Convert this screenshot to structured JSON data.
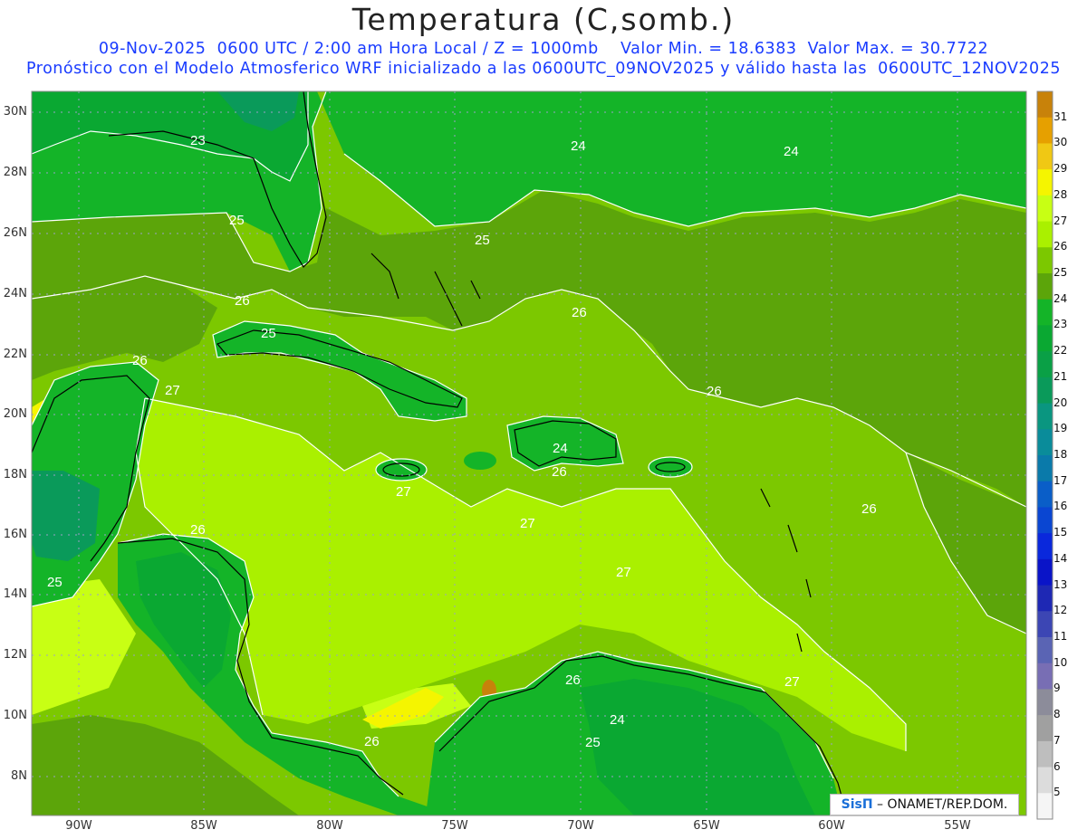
{
  "header": {
    "title": "Temperatura (C,somb.)",
    "subtitle1": "09-Nov-2025  0600 UTC / 2:00 am Hora Local / Z = 1000mb    Valor Min. = 18.6383  Valor Max. = 30.7722",
    "subtitle2": "Pronóstico con el Modelo Atmosferico WRF inicializado a las 0600UTC_09NOV2025 y válido hasta las  0600UTC_12NOV2025"
  },
  "map": {
    "lon_range": [
      -92,
      -53.5
    ],
    "lat_range": [
      6.8,
      30.8
    ],
    "y_axis_labels": [
      "30N",
      "28N",
      "26N",
      "24N",
      "22N",
      "20N",
      "18N",
      "16N",
      "14N",
      "12N",
      "10N",
      "8N"
    ],
    "x_axis_labels": [
      "90W",
      "85W",
      "80W",
      "75W",
      "70W",
      "65W",
      "60W",
      "55W"
    ],
    "contour_labels": [
      "23",
      "24",
      "24",
      "25",
      "25",
      "26",
      "26",
      "26",
      "26",
      "27",
      "27",
      "27",
      "27",
      "27",
      "25",
      "26",
      "24",
      "26",
      "26",
      "25",
      "24",
      "25",
      "26",
      "26"
    ],
    "colors": {
      "c23": "#0aa832",
      "c24": "#14b428",
      "c25": "#5ca50a",
      "c26": "#7cc800",
      "c27": "#aaf000",
      "c28": "#c8ff14",
      "c29": "#f5f500",
      "c30": "#f0c814",
      "c21": "#0a9a5a",
      "c22": "#0aa046"
    }
  },
  "colorbar": {
    "levels": [
      "31",
      "30",
      "29",
      "28",
      "27",
      "26",
      "25",
      "24",
      "23",
      "22",
      "21",
      "20",
      "19",
      "18",
      "17",
      "16",
      "15",
      "14",
      "13",
      "12",
      "11",
      "10",
      "9",
      "8",
      "7",
      "6",
      "5"
    ],
    "colors": [
      "#c8820a",
      "#e6a000",
      "#f0c814",
      "#f5f500",
      "#c8ff14",
      "#aaf000",
      "#7cc800",
      "#5ca50a",
      "#14b428",
      "#0aa832",
      "#0aa046",
      "#0a9a5a",
      "#0a9680",
      "#0a8c9a",
      "#0a7aaa",
      "#0a5ec8",
      "#0a46d2",
      "#0a28dc",
      "#0a14c8",
      "#1e28b4",
      "#3c46b4",
      "#5a64b4",
      "#786eb4",
      "#8c8c9a",
      "#a0a0a0",
      "#bebebe",
      "#dcdcdc",
      "#f5f5f5"
    ]
  },
  "footer": {
    "credit_logo": "SisΠ",
    "credit_text": "– ONAMET/REP.DOM."
  }
}
